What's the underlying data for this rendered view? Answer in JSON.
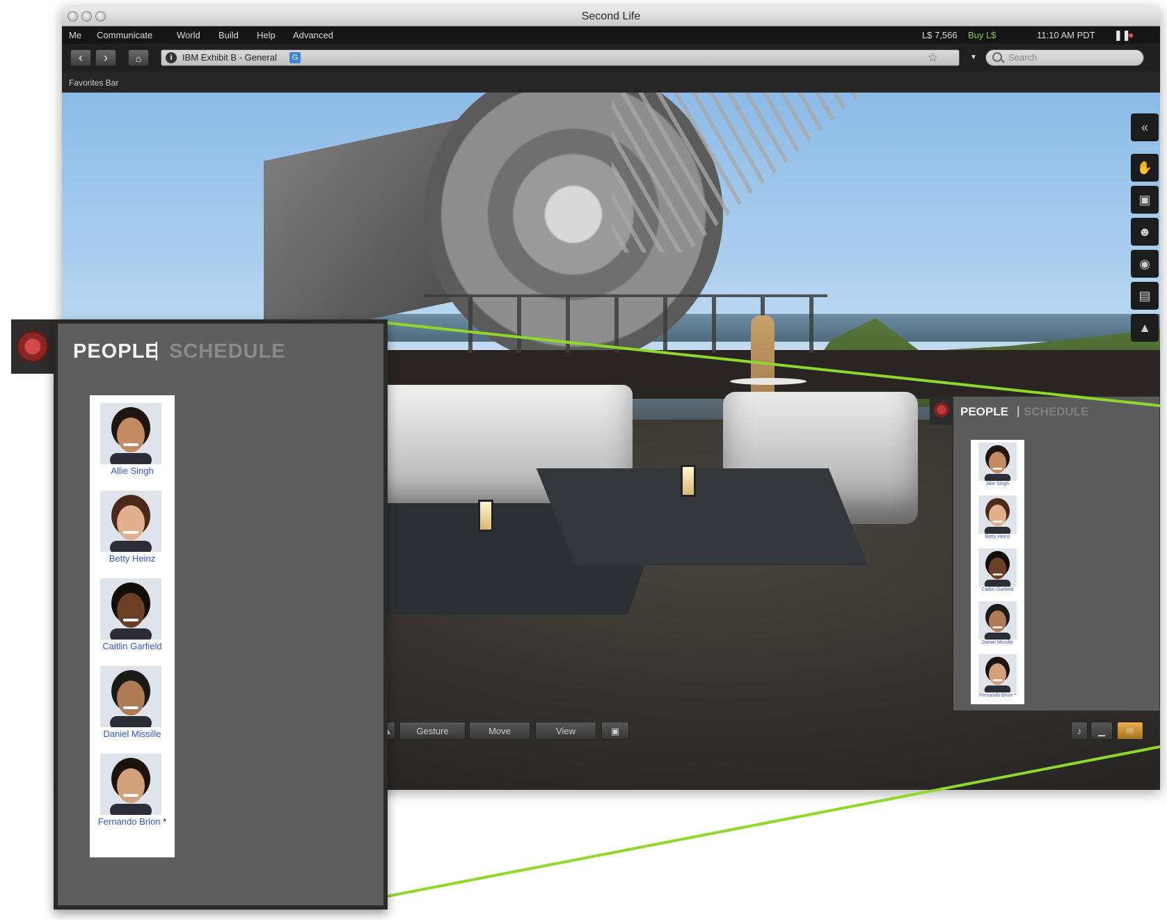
{
  "window": {
    "title": "Second Life",
    "menu": [
      "Me",
      "Communicate",
      "World",
      "Build",
      "Help",
      "Advanced"
    ],
    "balance": "L$ 7,566",
    "buy_link": "Buy L$",
    "clock": "11:10 AM PDT",
    "location": "IBM Exhibit B - General",
    "location_badge": "G",
    "search_placeholder": "Search",
    "favorites_label": "Favorites Bar"
  },
  "bottom_toolbar": {
    "gesture": "Gesture",
    "move": "Move",
    "view": "View"
  },
  "people_panel": {
    "heading_people": "PEOPLE",
    "separator": "|",
    "heading_schedule": "SCHEDULE",
    "people": [
      {
        "name": "Allie Singh"
      },
      {
        "name": "Betty Heinz"
      },
      {
        "name": "Caitlin Garfield"
      },
      {
        "name": "Daniel Missille"
      },
      {
        "name": "Fernando Brion"
      }
    ],
    "last_marker": "*"
  },
  "colors": {
    "accent_green": "#8fd82a",
    "link_blue": "#3355cc",
    "buy_green": "#7fcf3c"
  },
  "icons": [
    "back-icon",
    "forward-icon",
    "home-icon",
    "info-icon",
    "star-icon",
    "search-icon",
    "pause-icon",
    "media-icon",
    "collapse-icon",
    "gesture-hand-icon",
    "profile-icon",
    "people-icon",
    "places-icon",
    "inventory-icon",
    "appearance-icon",
    "camera-icon",
    "chat-icon"
  ]
}
